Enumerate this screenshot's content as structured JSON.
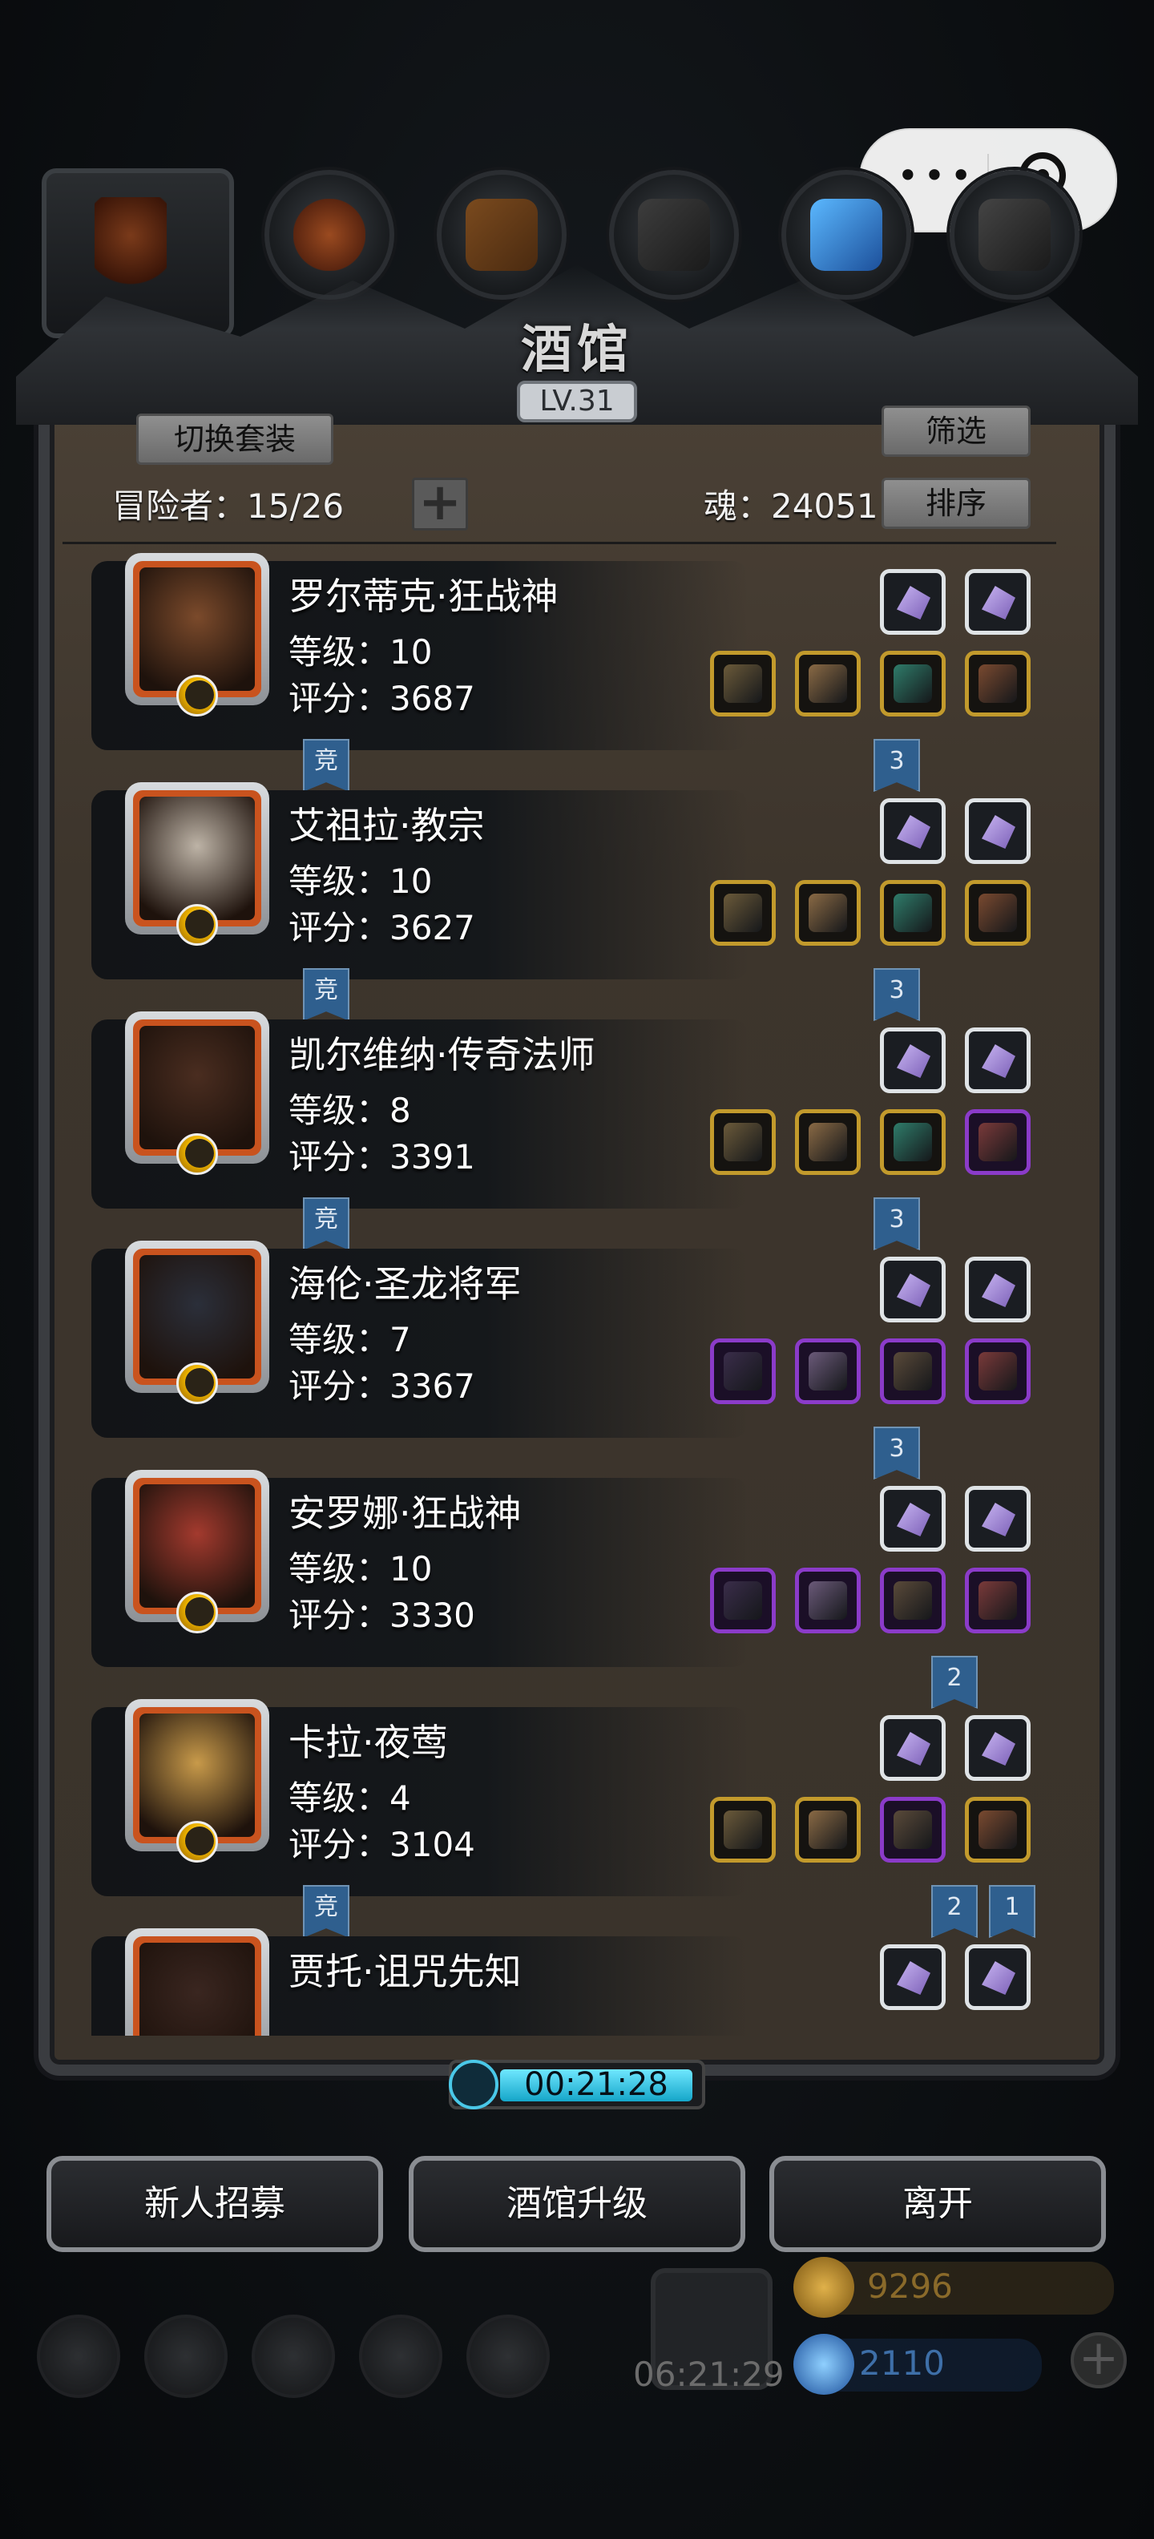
{
  "header": {
    "title": "酒馆",
    "level": "LV.31"
  },
  "controls": {
    "switch_outfit": "切换套装",
    "filter": "筛选",
    "sort": "排序",
    "adventurers_label": "冒险者：15/26",
    "soul_label": "魂：24051",
    "add_icon": "plus-icon"
  },
  "heroes": [
    {
      "name": "罗尔蒂克·狂战神",
      "level": "等级：10",
      "score": "评分：3687",
      "equip": [
        "gold",
        "gold",
        "gold",
        "gold"
      ],
      "badges": [
        {
          "side": "left",
          "text": "竞"
        },
        {
          "side": "right",
          "text": "3"
        }
      ]
    },
    {
      "name": "艾祖拉·教宗",
      "level": "等级：10",
      "score": "评分：3627",
      "equip": [
        "gold",
        "gold",
        "gold",
        "gold"
      ],
      "badges": [
        {
          "side": "left",
          "text": "竞"
        },
        {
          "side": "right",
          "text": "3"
        }
      ]
    },
    {
      "name": "凯尔维纳·传奇法师",
      "level": "等级：8",
      "score": "评分：3391",
      "equip": [
        "gold",
        "gold",
        "gold",
        "purple"
      ],
      "badges": [
        {
          "side": "left",
          "text": "竞"
        },
        {
          "side": "right",
          "text": "3"
        }
      ]
    },
    {
      "name": "海伦·圣龙将军",
      "level": "等级：7",
      "score": "评分：3367",
      "equip": [
        "purple",
        "purple",
        "purple",
        "purple"
      ],
      "badges": [
        {
          "side": "right",
          "text": "3"
        }
      ]
    },
    {
      "name": "安罗娜·狂战神",
      "level": "等级：10",
      "score": "评分：3330",
      "equip": [
        "purple",
        "purple",
        "purple",
        "purple"
      ],
      "badges": [
        {
          "side": "right2",
          "text": "2"
        }
      ]
    },
    {
      "name": "卡拉·夜莺",
      "level": "等级：4",
      "score": "评分：3104",
      "equip": [
        "gold",
        "gold",
        "purple",
        "gold"
      ],
      "badges": [
        {
          "side": "left",
          "text": "竞"
        },
        {
          "side": "right2",
          "text": "2"
        },
        {
          "side": "right1",
          "text": "1"
        }
      ]
    },
    {
      "name": "贾托·诅咒先知",
      "level": "",
      "score": "",
      "equip": [],
      "badges": []
    }
  ],
  "timer": {
    "value": "00:21:28"
  },
  "actions": {
    "recruit": "新人招募",
    "upgrade": "酒馆升级",
    "leave": "离开"
  },
  "hud": {
    "gift_timer": "06:21:29",
    "gold": "9296",
    "gems": "2110"
  },
  "colors": {
    "gold_frame": "#c29a2c",
    "purple_frame": "#8b3bc9",
    "badge": "#2f5f8e",
    "timer": "#15a6c9"
  }
}
